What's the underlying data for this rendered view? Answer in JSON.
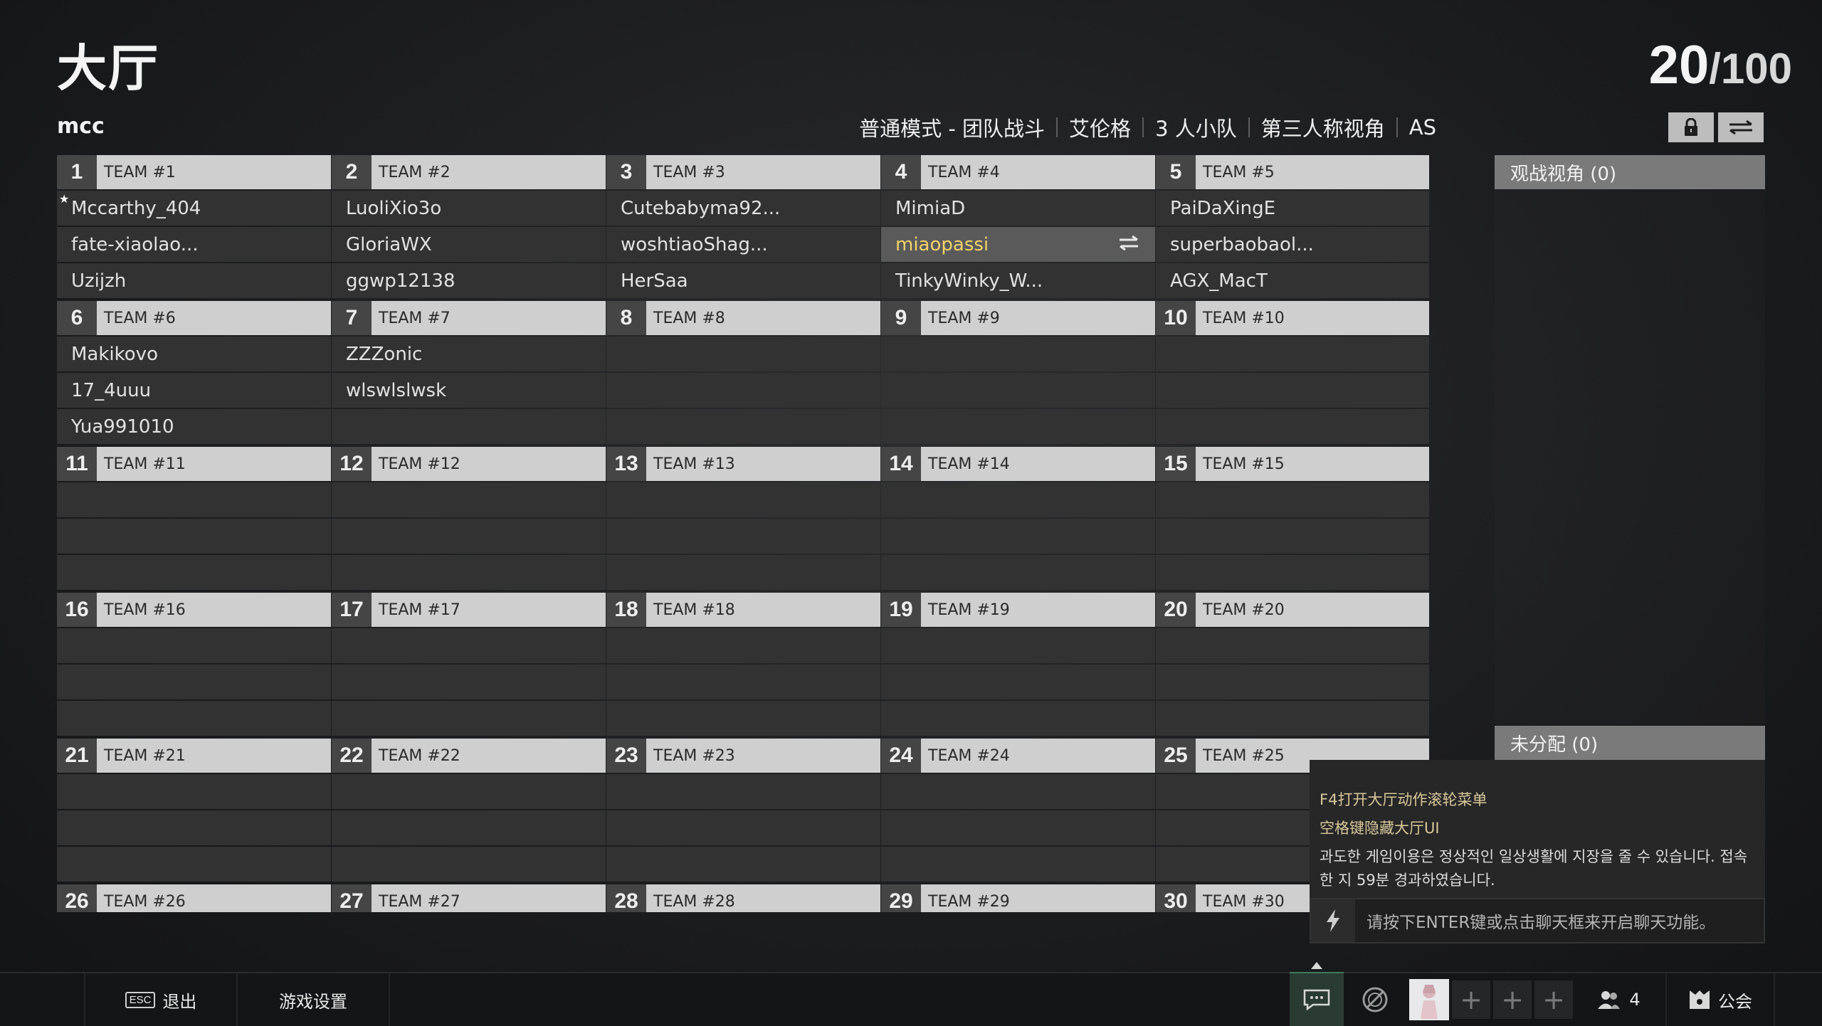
{
  "header": {
    "title": "大厅",
    "player_count": "20",
    "player_max": "/100",
    "lobby_name": "mcc",
    "mode_tags": [
      "普通模式 - 团队战斗",
      "艾伦格",
      "3 人小队",
      "第三人称视角",
      "AS"
    ]
  },
  "icons": {
    "lock": "lock-icon",
    "swap": "swap-arrows-icon"
  },
  "teams": [
    {
      "num": "1",
      "name": "TEAM #1",
      "players": [
        "Mccarthy_404",
        "fate-xiaolao...",
        "Uzijzh"
      ]
    },
    {
      "num": "2",
      "name": "TEAM #2",
      "players": [
        "LuoliXio3o",
        "GloriaWX",
        "ggwp12138"
      ]
    },
    {
      "num": "3",
      "name": "TEAM #3",
      "players": [
        "Cutebabyma92...",
        "woshtiaoShag...",
        "HerSaa"
      ]
    },
    {
      "num": "4",
      "name": "TEAM #4",
      "players": [
        "MimiaD",
        "miaopassi",
        "TinkyWinky_W..."
      ]
    },
    {
      "num": "5",
      "name": "TEAM #5",
      "players": [
        "PaiDaXingE",
        "superbaobaol...",
        "AGX_MacT"
      ]
    },
    {
      "num": "6",
      "name": "TEAM #6",
      "players": [
        "Makikovo",
        "17_4uuu",
        "Yua991010"
      ]
    },
    {
      "num": "7",
      "name": "TEAM #7",
      "players": [
        "ZZZonic",
        "wlswlslwsk",
        ""
      ]
    },
    {
      "num": "8",
      "name": "TEAM #8",
      "players": [
        "",
        "",
        ""
      ]
    },
    {
      "num": "9",
      "name": "TEAM #9",
      "players": [
        "",
        "",
        ""
      ]
    },
    {
      "num": "10",
      "name": "TEAM #10",
      "players": [
        "",
        "",
        ""
      ]
    },
    {
      "num": "11",
      "name": "TEAM #11",
      "players": [
        "",
        "",
        ""
      ]
    },
    {
      "num": "12",
      "name": "TEAM #12",
      "players": [
        "",
        "",
        ""
      ]
    },
    {
      "num": "13",
      "name": "TEAM #13",
      "players": [
        "",
        "",
        ""
      ]
    },
    {
      "num": "14",
      "name": "TEAM #14",
      "players": [
        "",
        "",
        ""
      ]
    },
    {
      "num": "15",
      "name": "TEAM #15",
      "players": [
        "",
        "",
        ""
      ]
    },
    {
      "num": "16",
      "name": "TEAM #16",
      "players": [
        "",
        "",
        ""
      ]
    },
    {
      "num": "17",
      "name": "TEAM #17",
      "players": [
        "",
        "",
        ""
      ]
    },
    {
      "num": "18",
      "name": "TEAM #18",
      "players": [
        "",
        "",
        ""
      ]
    },
    {
      "num": "19",
      "name": "TEAM #19",
      "players": [
        "",
        "",
        ""
      ]
    },
    {
      "num": "20",
      "name": "TEAM #20",
      "players": [
        "",
        "",
        ""
      ]
    },
    {
      "num": "21",
      "name": "TEAM #21",
      "players": [
        "",
        "",
        ""
      ]
    },
    {
      "num": "22",
      "name": "TEAM #22",
      "players": [
        "",
        "",
        ""
      ]
    },
    {
      "num": "23",
      "name": "TEAM #23",
      "players": [
        "",
        "",
        ""
      ]
    },
    {
      "num": "24",
      "name": "TEAM #24",
      "players": [
        "",
        "",
        ""
      ]
    },
    {
      "num": "25",
      "name": "TEAM #25",
      "players": [
        "",
        "",
        ""
      ]
    },
    {
      "num": "26",
      "name": "TEAM #26",
      "players": [
        "",
        "",
        ""
      ]
    },
    {
      "num": "27",
      "name": "TEAM #27",
      "players": [
        "",
        "",
        ""
      ]
    },
    {
      "num": "28",
      "name": "TEAM #28",
      "players": [
        "",
        "",
        ""
      ]
    },
    {
      "num": "29",
      "name": "TEAM #29",
      "players": [
        "",
        "",
        ""
      ]
    },
    {
      "num": "30",
      "name": "TEAM #30",
      "players": [
        "",
        "",
        ""
      ]
    }
  ],
  "highlight_player": "miaopassi",
  "leader_player": "Mccarthy_404",
  "colors": {
    "highlight_text": "#f3d36b",
    "team_header": "#cfcfcf",
    "slot_bg": "#323232"
  },
  "side": {
    "spectators": "观战视角 (0)",
    "unassigned": "未分配 (0)"
  },
  "notice": {
    "line1": "F4打开大厅动作滚轮菜单",
    "line2": "空格键隐藏大厅UI",
    "warning": "과도한 게임이용은 정상적인 일상생활에 지장을 줄 수 있습니다. 접속한 지 59분 경과하였습니다."
  },
  "chat": {
    "placeholder": "请按下ENTER键或点击聊天框来开启聊天功能。"
  },
  "bottom": {
    "esc_key": "ESC",
    "exit_label": "退出",
    "settings_label": "游戏设置",
    "party_count": "4",
    "guild_label": "公会",
    "invite_plus": "+"
  }
}
